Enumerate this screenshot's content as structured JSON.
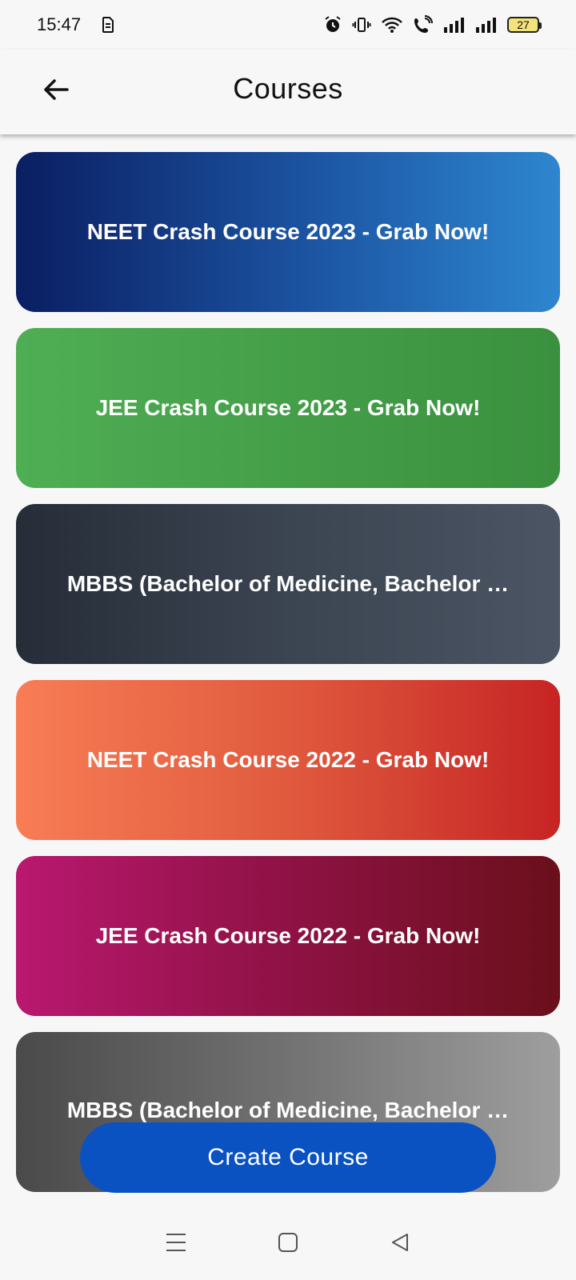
{
  "status_bar": {
    "time": "15:47",
    "battery": "27",
    "icons": [
      "sim-card-icon",
      "alarm-icon",
      "vibrate-icon",
      "wifi-icon",
      "wifi-call-icon",
      "signal-icon",
      "signal-icon",
      "battery-icon"
    ]
  },
  "app_bar": {
    "title": "Courses",
    "back_icon": "arrow-left-icon"
  },
  "courses": [
    {
      "title": "NEET Crash Course 2023 - Grab Now!",
      "colors": [
        "#0b1e62",
        "#2e86cf"
      ]
    },
    {
      "title": "JEE Crash Course 2023 - Grab Now!",
      "colors": [
        "#4fae54",
        "#3a903e"
      ]
    },
    {
      "title": "MBBS (Bachelor of Medicine, Bachelor …",
      "colors": [
        "#262d38",
        "#4b5563"
      ]
    },
    {
      "title": "NEET Crash Course 2022 - Grab Now!",
      "colors": [
        "#f87d55",
        "#c62424"
      ]
    },
    {
      "title": "JEE Crash Course 2022 - Grab Now!",
      "colors": [
        "#b9186f",
        "#6b0f1b"
      ]
    },
    {
      "title": "MBBS (Bachelor of Medicine, Bachelor …",
      "colors": [
        "#4a4a4a",
        "#9e9e9e"
      ]
    }
  ],
  "create_button": {
    "label": "Create Course",
    "color": "#0a52c2"
  },
  "nav_bar": {
    "icons": [
      "menu-icon",
      "home-square-icon",
      "back-triangle-icon"
    ]
  }
}
